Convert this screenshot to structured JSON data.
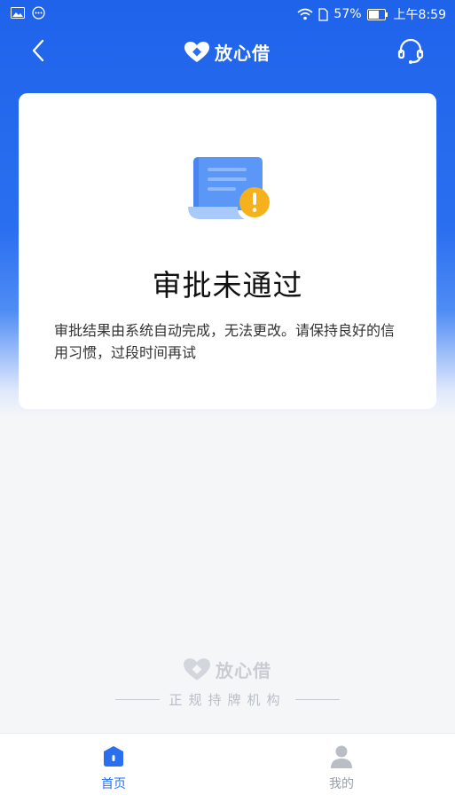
{
  "status_bar": {
    "battery": "57%",
    "time": "上午8:59",
    "icons": [
      "image-icon",
      "message-icon",
      "wifi-icon",
      "sim-icon",
      "battery-icon"
    ]
  },
  "nav": {
    "brand": "放心借",
    "back_icon": "chevron-left-icon",
    "service_icon": "headset-icon"
  },
  "result": {
    "title": "审批未通过",
    "description": "审批结果由系统自动完成，无法更改。请保持良好的信用习惯，过段时间再试",
    "icon": "document-warning-icon"
  },
  "footer": {
    "brand": "放心借",
    "tagline": "正规持牌机构"
  },
  "tabbar": {
    "home_label": "首页",
    "mine_label": "我的"
  },
  "colors": {
    "primary": "#2a6ff0",
    "warning": "#f5b21c"
  }
}
